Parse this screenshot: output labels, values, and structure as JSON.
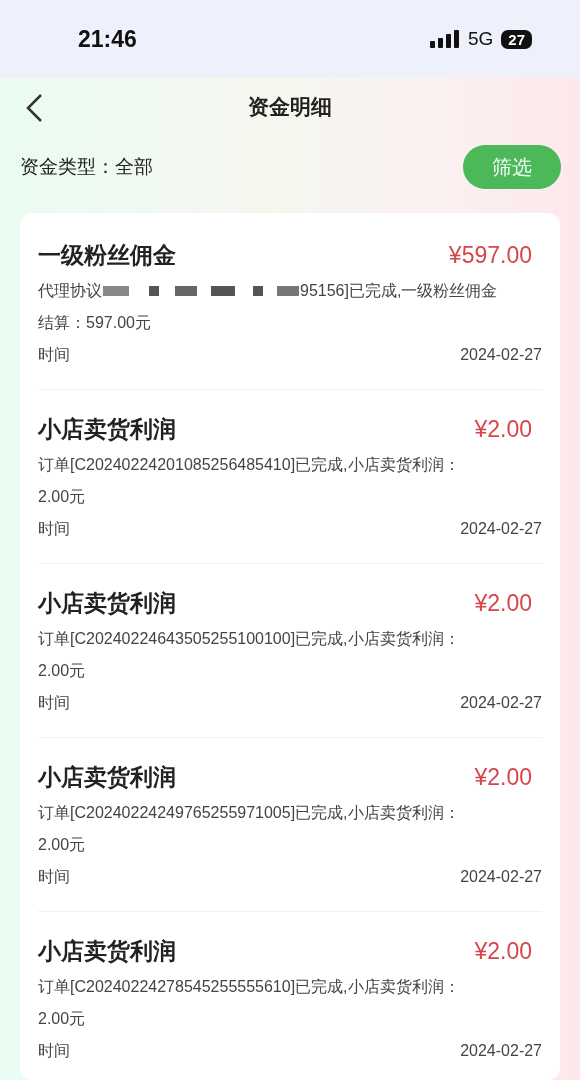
{
  "status_bar": {
    "time": "21:46",
    "network": "5G",
    "battery": "27"
  },
  "nav": {
    "title": "资金明细"
  },
  "filter": {
    "label": "资金类型：全部",
    "button": "筛选"
  },
  "records": [
    {
      "title": "一级粉丝佣金",
      "amount": "¥597.00",
      "lines": [
        {
          "text": "代理协议",
          "redacted": true,
          "after": "95156]已完成,一级粉丝佣金"
        },
        {
          "text": "结算：597.00元"
        }
      ],
      "time_label": "时间",
      "date": "2024-02-27"
    },
    {
      "title": "小店卖货利润",
      "amount": "¥2.00",
      "lines": [
        {
          "text": "订单[C20240224201085256485410]已完成,小店卖货利润："
        },
        {
          "text": "2.00元"
        }
      ],
      "time_label": "时间",
      "date": "2024-02-27"
    },
    {
      "title": "小店卖货利润",
      "amount": "¥2.00",
      "lines": [
        {
          "text": "订单[C20240224643505255100100]已完成,小店卖货利润："
        },
        {
          "text": "2.00元"
        }
      ],
      "time_label": "时间",
      "date": "2024-02-27"
    },
    {
      "title": "小店卖货利润",
      "amount": "¥2.00",
      "lines": [
        {
          "text": "订单[C20240224249765255971005]已完成,小店卖货利润："
        },
        {
          "text": "2.00元"
        }
      ],
      "time_label": "时间",
      "date": "2024-02-27"
    },
    {
      "title": "小店卖货利润",
      "amount": "¥2.00",
      "lines": [
        {
          "text": "订单[C20240224278545255555610]已完成,小店卖货利润："
        },
        {
          "text": "2.00元"
        }
      ],
      "time_label": "时间",
      "date": "2024-02-27"
    }
  ]
}
